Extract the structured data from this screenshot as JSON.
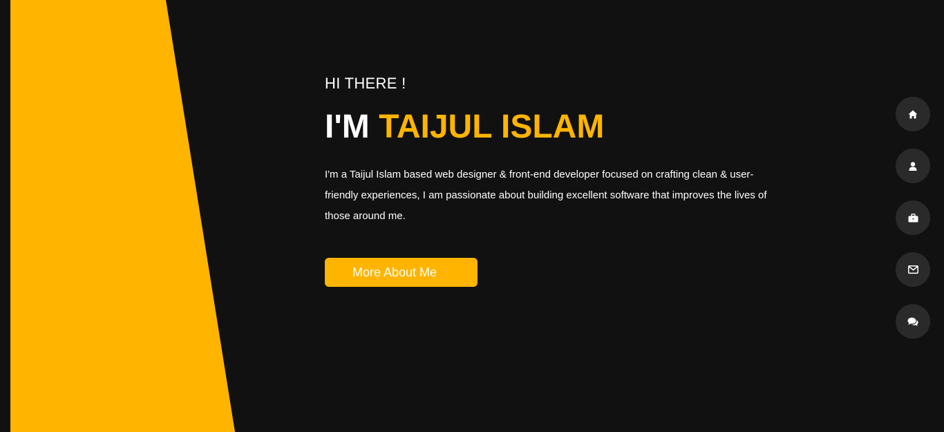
{
  "hero": {
    "greeting": "HI THERE !",
    "headline_prefix": "I'M ",
    "headline_name": "TAIJUL ISLAM",
    "intro": "I'm a Taijul Islam based web designer & front-end developer focused on crafting clean & user-friendly experiences, I am passionate about building excellent software that improves the lives of those around me.",
    "cta_label": "More About Me"
  },
  "side_nav": {
    "items": [
      {
        "icon": "home-icon"
      },
      {
        "icon": "user-icon"
      },
      {
        "icon": "briefcase-icon"
      },
      {
        "icon": "envelope-icon"
      },
      {
        "icon": "comments-icon"
      }
    ]
  },
  "colors": {
    "background": "#111111",
    "accent": "#ffb400",
    "nav_button": "#2b2a2a",
    "text": "#ffffff"
  }
}
